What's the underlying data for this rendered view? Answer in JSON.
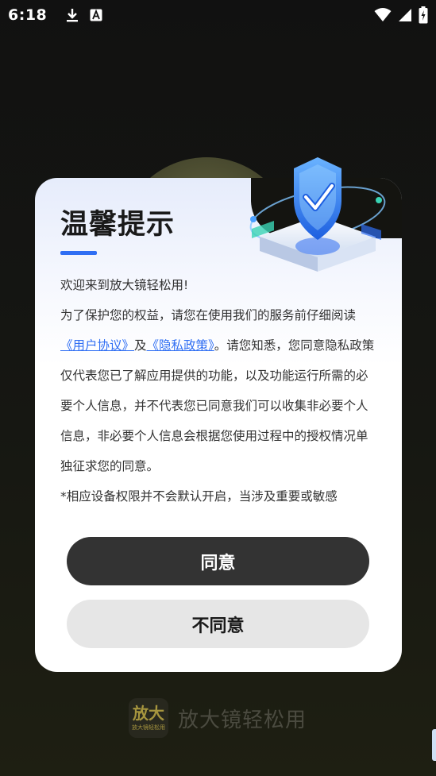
{
  "status_bar": {
    "time": "6:18",
    "icons": [
      "download-icon",
      "text-a-icon",
      "wifi-icon",
      "cell-signal-icon",
      "battery-icon"
    ]
  },
  "dialog": {
    "title": "温馨提示",
    "welcome": "欢迎来到放大镜轻松用!",
    "para1_pre": "为了保护您的权益，请您在使用我们的服务前仔细阅读",
    "user_agreement": "《用户协议》",
    "and": "及",
    "privacy_policy": "《隐私政策》",
    "para1_post": "。请您知悉，您同意隐私政策仅代表您已了解应用提供的功能，以及功能运行所需的必要个人信息，并不代表您已同意我们可以收集非必要个人信息，非必要个人信息会根据您使用过程中的授权情况单独征求您的同意。",
    "para2": "*相应设备权限并不会默认开启，当涉及重要或敏感",
    "agree_label": "同意",
    "disagree_label": "不同意"
  },
  "brand": {
    "logo_main": "放大",
    "logo_sub": "放大镜轻松用",
    "name": "放大镜轻松用"
  },
  "colors": {
    "accent": "#2f6ef3",
    "agree_bg": "#333333",
    "disagree_bg": "#e6e6e6"
  }
}
